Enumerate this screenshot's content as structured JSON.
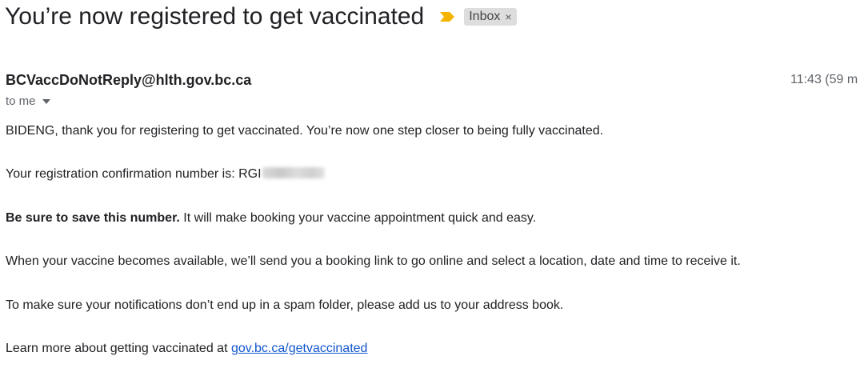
{
  "email": {
    "subject": "You’re now registered to get vaccinated",
    "label": "Inbox",
    "label_remove": "×",
    "importance_icon": "importance-marker-icon",
    "importance_color": "#f4b400",
    "sender": "BCVaccDoNotReply@hlth.gov.bc.ca",
    "time": "11:43 (59 m",
    "recipient": "to me",
    "body": {
      "p1": "BIDENG, thank you for registering to get vaccinated. You’re now one step closer to being fully vaccinated.",
      "p2_text": "Your registration confirmation number is: RGI",
      "p3_bold": "Be sure to save this number.",
      "p3_rest": " It will make booking your vaccine appointment quick and easy.",
      "p4": "When your vaccine becomes available, we’ll send you a booking link to go online and select a location, date and time to receive it.",
      "p5": "To make sure your notifications don’t end up in a spam folder, please add us to your address book.",
      "p6_text": "Learn more about getting vaccinated at ",
      "p6_link": "gov.bc.ca/getvaccinated"
    }
  }
}
